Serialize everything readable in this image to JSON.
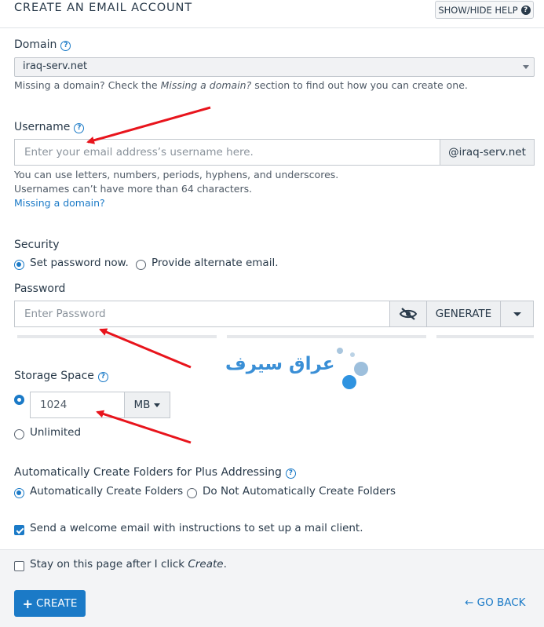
{
  "header": {
    "title": "CREATE AN EMAIL ACCOUNT",
    "help_button": "SHOW/HIDE HELP"
  },
  "domain": {
    "label": "Domain",
    "value": "iraq-serv.net",
    "help_prefix": "Missing a domain? Check the ",
    "help_em": "Missing a domain?",
    "help_suffix": " section to find out how you can create one."
  },
  "username": {
    "label": "Username",
    "placeholder": "Enter your email address’s username here.",
    "suffix": "@iraq-serv.net",
    "help_line1": "You can use letters, numbers, periods, hyphens, and underscores.",
    "help_line2": "Usernames can’t have more than 64 characters.",
    "link": "Missing a domain?"
  },
  "security": {
    "label": "Security",
    "option_set": "Set password now.",
    "option_alt": "Provide alternate email."
  },
  "password": {
    "label": "Password",
    "placeholder": "Enter Password",
    "generate": "GENERATE"
  },
  "storage": {
    "label": "Storage Space",
    "value": "1024",
    "unit": "MB",
    "unlimited": "Unlimited"
  },
  "folders": {
    "label": "Automatically Create Folders for Plus Addressing",
    "option_auto": "Automatically Create Folders",
    "option_no": "Do Not Automatically Create Folders"
  },
  "welcome": {
    "label": "Send a welcome email with instructions to set up a mail client."
  },
  "stay": {
    "prefix": "Stay on this page after I click ",
    "em": "Create",
    "suffix": "."
  },
  "actions": {
    "create": "CREATE",
    "go_back": "GO BACK"
  },
  "watermark": {
    "text": "عراق سيرف"
  },
  "colors": {
    "accent": "#1b7ac7",
    "arrow": "#e8141c",
    "text": "#293a4a"
  }
}
